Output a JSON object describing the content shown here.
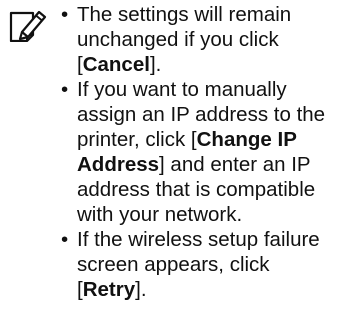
{
  "note": {
    "icon": "memo-pencil-icon",
    "items": [
      {
        "lines": [
          [
            {
              "t": "The settings will remain"
            }
          ],
          [
            {
              "t": "unchanged if you click"
            }
          ],
          [
            {
              "t": "["
            },
            {
              "t": "Cancel",
              "b": true
            },
            {
              "t": "]."
            }
          ]
        ]
      },
      {
        "lines": [
          [
            {
              "t": "If you want to manually"
            }
          ],
          [
            {
              "t": "assign an IP address to the"
            }
          ],
          [
            {
              "t": "printer, click ["
            },
            {
              "t": "Change IP",
              "b": true
            }
          ],
          [
            {
              "t": "Address",
              "b": true
            },
            {
              "t": "] and enter an IP"
            }
          ],
          [
            {
              "t": "address that is compatible"
            }
          ],
          [
            {
              "t": "with your network."
            }
          ]
        ]
      },
      {
        "lines": [
          [
            {
              "t": "If the wireless setup failure"
            }
          ],
          [
            {
              "t": "screen appears, click"
            }
          ],
          [
            {
              "t": "["
            },
            {
              "t": "Retry",
              "b": true
            },
            {
              "t": "]."
            }
          ]
        ]
      }
    ]
  }
}
